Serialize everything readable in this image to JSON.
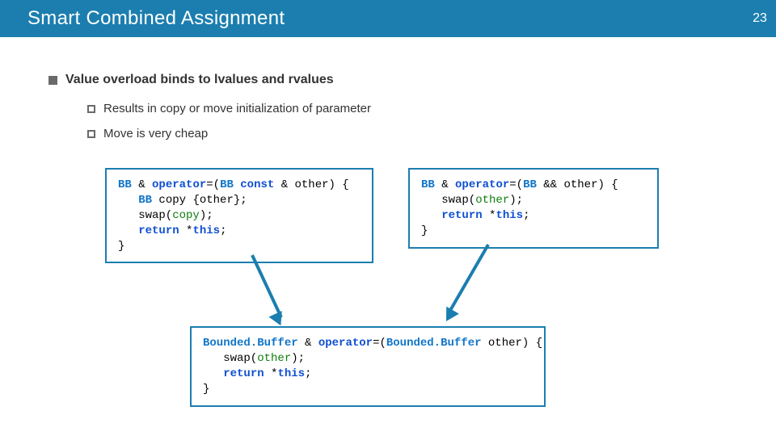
{
  "header": {
    "title": "Smart Combined Assignment",
    "page_number": "23"
  },
  "bullets": {
    "main": "Value overload binds to lvalues and rvalues",
    "sub1": "Results in copy or move initialization of parameter",
    "sub2": "Move is very cheap"
  },
  "code": {
    "left": {
      "l1a": "BB",
      "l1b": " & ",
      "l1c": "operator",
      "l1d": "=(",
      "l1e": "BB",
      "l1f": " const",
      "l1g": " & other) {",
      "l2a": "   ",
      "l2b": "BB",
      "l2c": " copy {other};",
      "l3a": "   swap(",
      "l3b": "copy",
      "l3c": ");",
      "l4a": "   ",
      "l4b": "return",
      "l4c": " *",
      "l4d": "this",
      "l4e": ";",
      "l5": "}"
    },
    "right": {
      "l1a": "BB",
      "l1b": " & ",
      "l1c": "operator",
      "l1d": "=(",
      "l1e": "BB",
      "l1f": " && other) {",
      "l2a": "   swap(",
      "l2b": "other",
      "l2c": ");",
      "l3a": "   ",
      "l3b": "return",
      "l3c": " *",
      "l3d": "this",
      "l3e": ";",
      "l4": "}"
    },
    "bottom": {
      "l1a": "Bounded.Buffer",
      "l1b": " & ",
      "l1c": "operator",
      "l1d": "=(",
      "l1e": "Bounded.Buffer",
      "l1f": " other) {",
      "l2a": "   swap(",
      "l2b": "other",
      "l2c": ");",
      "l3a": "   ",
      "l3b": "return",
      "l3c": " *",
      "l3d": "this",
      "l3e": ";",
      "l4": "}"
    }
  }
}
